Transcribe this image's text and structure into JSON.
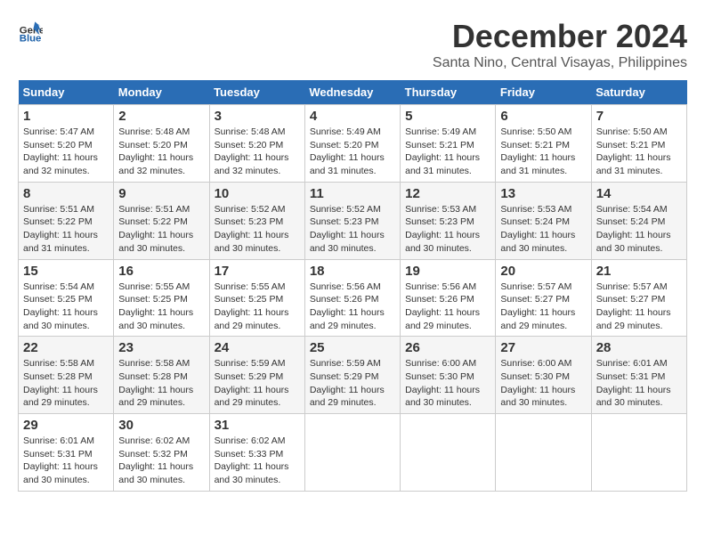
{
  "header": {
    "logo_line1": "General",
    "logo_line2": "Blue",
    "month": "December 2024",
    "location": "Santa Nino, Central Visayas, Philippines"
  },
  "weekdays": [
    "Sunday",
    "Monday",
    "Tuesday",
    "Wednesday",
    "Thursday",
    "Friday",
    "Saturday"
  ],
  "weeks": [
    [
      {
        "day": "1",
        "sunrise": "5:47 AM",
        "sunset": "5:20 PM",
        "daylight": "11 hours and 32 minutes."
      },
      {
        "day": "2",
        "sunrise": "5:48 AM",
        "sunset": "5:20 PM",
        "daylight": "11 hours and 32 minutes."
      },
      {
        "day": "3",
        "sunrise": "5:48 AM",
        "sunset": "5:20 PM",
        "daylight": "11 hours and 32 minutes."
      },
      {
        "day": "4",
        "sunrise": "5:49 AM",
        "sunset": "5:20 PM",
        "daylight": "11 hours and 31 minutes."
      },
      {
        "day": "5",
        "sunrise": "5:49 AM",
        "sunset": "5:21 PM",
        "daylight": "11 hours and 31 minutes."
      },
      {
        "day": "6",
        "sunrise": "5:50 AM",
        "sunset": "5:21 PM",
        "daylight": "11 hours and 31 minutes."
      },
      {
        "day": "7",
        "sunrise": "5:50 AM",
        "sunset": "5:21 PM",
        "daylight": "11 hours and 31 minutes."
      }
    ],
    [
      {
        "day": "8",
        "sunrise": "5:51 AM",
        "sunset": "5:22 PM",
        "daylight": "11 hours and 31 minutes."
      },
      {
        "day": "9",
        "sunrise": "5:51 AM",
        "sunset": "5:22 PM",
        "daylight": "11 hours and 30 minutes."
      },
      {
        "day": "10",
        "sunrise": "5:52 AM",
        "sunset": "5:23 PM",
        "daylight": "11 hours and 30 minutes."
      },
      {
        "day": "11",
        "sunrise": "5:52 AM",
        "sunset": "5:23 PM",
        "daylight": "11 hours and 30 minutes."
      },
      {
        "day": "12",
        "sunrise": "5:53 AM",
        "sunset": "5:23 PM",
        "daylight": "11 hours and 30 minutes."
      },
      {
        "day": "13",
        "sunrise": "5:53 AM",
        "sunset": "5:24 PM",
        "daylight": "11 hours and 30 minutes."
      },
      {
        "day": "14",
        "sunrise": "5:54 AM",
        "sunset": "5:24 PM",
        "daylight": "11 hours and 30 minutes."
      }
    ],
    [
      {
        "day": "15",
        "sunrise": "5:54 AM",
        "sunset": "5:25 PM",
        "daylight": "11 hours and 30 minutes."
      },
      {
        "day": "16",
        "sunrise": "5:55 AM",
        "sunset": "5:25 PM",
        "daylight": "11 hours and 30 minutes."
      },
      {
        "day": "17",
        "sunrise": "5:55 AM",
        "sunset": "5:25 PM",
        "daylight": "11 hours and 29 minutes."
      },
      {
        "day": "18",
        "sunrise": "5:56 AM",
        "sunset": "5:26 PM",
        "daylight": "11 hours and 29 minutes."
      },
      {
        "day": "19",
        "sunrise": "5:56 AM",
        "sunset": "5:26 PM",
        "daylight": "11 hours and 29 minutes."
      },
      {
        "day": "20",
        "sunrise": "5:57 AM",
        "sunset": "5:27 PM",
        "daylight": "11 hours and 29 minutes."
      },
      {
        "day": "21",
        "sunrise": "5:57 AM",
        "sunset": "5:27 PM",
        "daylight": "11 hours and 29 minutes."
      }
    ],
    [
      {
        "day": "22",
        "sunrise": "5:58 AM",
        "sunset": "5:28 PM",
        "daylight": "11 hours and 29 minutes."
      },
      {
        "day": "23",
        "sunrise": "5:58 AM",
        "sunset": "5:28 PM",
        "daylight": "11 hours and 29 minutes."
      },
      {
        "day": "24",
        "sunrise": "5:59 AM",
        "sunset": "5:29 PM",
        "daylight": "11 hours and 29 minutes."
      },
      {
        "day": "25",
        "sunrise": "5:59 AM",
        "sunset": "5:29 PM",
        "daylight": "11 hours and 29 minutes."
      },
      {
        "day": "26",
        "sunrise": "6:00 AM",
        "sunset": "5:30 PM",
        "daylight": "11 hours and 30 minutes."
      },
      {
        "day": "27",
        "sunrise": "6:00 AM",
        "sunset": "5:30 PM",
        "daylight": "11 hours and 30 minutes."
      },
      {
        "day": "28",
        "sunrise": "6:01 AM",
        "sunset": "5:31 PM",
        "daylight": "11 hours and 30 minutes."
      }
    ],
    [
      {
        "day": "29",
        "sunrise": "6:01 AM",
        "sunset": "5:31 PM",
        "daylight": "11 hours and 30 minutes."
      },
      {
        "day": "30",
        "sunrise": "6:02 AM",
        "sunset": "5:32 PM",
        "daylight": "11 hours and 30 minutes."
      },
      {
        "day": "31",
        "sunrise": "6:02 AM",
        "sunset": "5:33 PM",
        "daylight": "11 hours and 30 minutes."
      },
      null,
      null,
      null,
      null
    ]
  ]
}
